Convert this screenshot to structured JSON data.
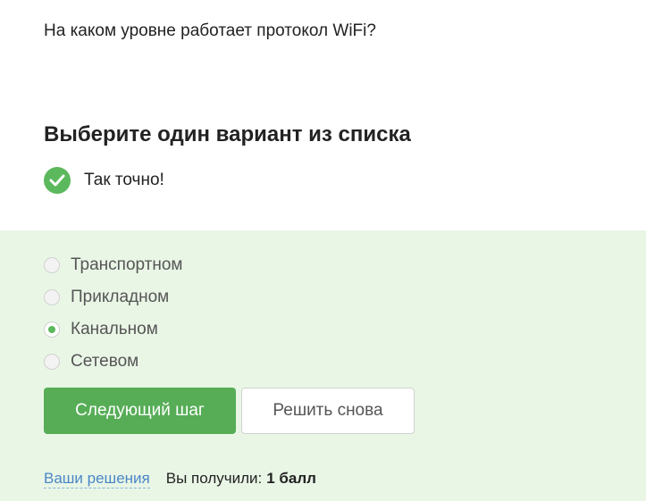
{
  "question": {
    "text": "На каком уровне работает протокол WiFi?"
  },
  "answer_section": {
    "heading": "Выберите один вариант из списка",
    "feedback_text": "Так точно!",
    "status_color": "#5cb85c"
  },
  "options": [
    {
      "label": "Транспортном",
      "selected": false
    },
    {
      "label": "Прикладном",
      "selected": false
    },
    {
      "label": "Канальном",
      "selected": true
    },
    {
      "label": "Сетевом",
      "selected": false
    }
  ],
  "buttons": {
    "next_label": "Следующий шаг",
    "retry_label": "Решить снова"
  },
  "footer": {
    "solutions_link": "Ваши решения",
    "score_label": "Вы получили:",
    "score_value": "1 балл"
  },
  "colors": {
    "accent": "#56ad56",
    "answer_area_bg": "#e9f6e6",
    "link": "#4a86c5"
  }
}
